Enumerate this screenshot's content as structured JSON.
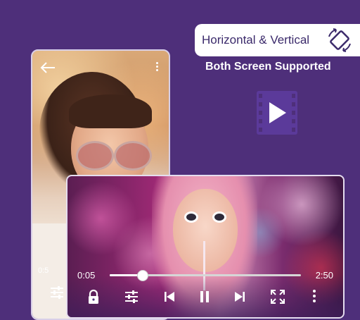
{
  "headline": {
    "title": "Horizontal & Vertical",
    "subtitle": "Both Screen Supported"
  },
  "portrait_player": {
    "time_current": "0:5"
  },
  "landscape_player": {
    "time_current": "0:05",
    "time_total": "2:50",
    "progress": 0.17
  },
  "icons": {
    "rotate": "rotate-icon",
    "video": "video-play-icon",
    "back": "back-arrow-icon",
    "menu": "more-vertical-icon",
    "equalizer": "equalizer-icon",
    "lock": "lock-icon",
    "previous": "skip-previous-icon",
    "pause": "pause-icon",
    "next": "skip-next-icon",
    "fullscreen": "fullscreen-icon"
  },
  "colors": {
    "background": "#4e2f7a",
    "badge_text": "#3b2a6b",
    "icon_purple": "#5b3a9a"
  }
}
